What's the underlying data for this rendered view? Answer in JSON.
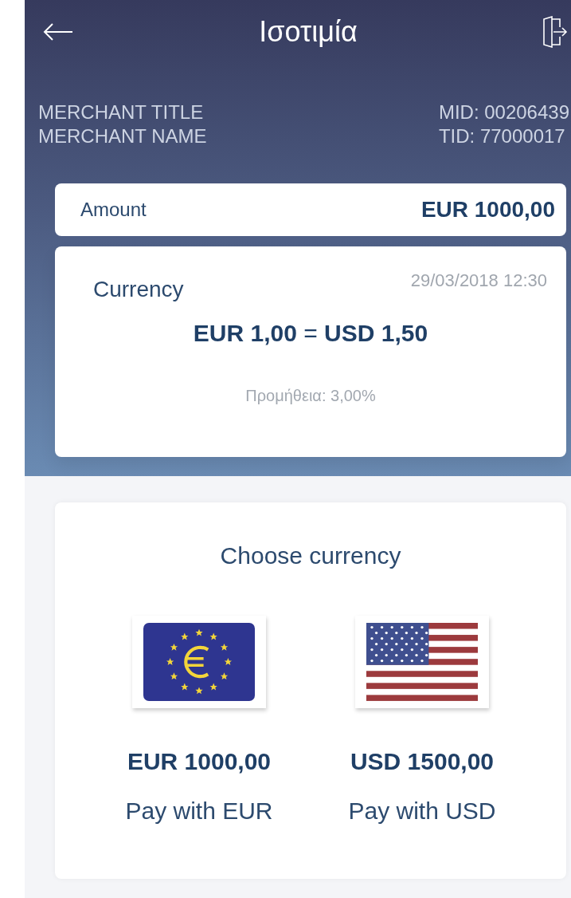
{
  "header": {
    "title": "Ισοτιμία"
  },
  "merchant": {
    "title": "MERCHANT TITLE",
    "name": "MERCHANT NAME",
    "mid": "MID: 00206439",
    "tid": "TID: 77000017"
  },
  "amount": {
    "label": "Amount",
    "value": "EUR 1000,00"
  },
  "currency": {
    "label": "Currency",
    "datetime": "29/03/2018 12:30",
    "rate": "**EUR 1,00** = **USD 1,50**",
    "fee": "Προμήθεια: 3,00%"
  },
  "choose": {
    "title": "Choose currency",
    "options": [
      {
        "kind": "eu",
        "amount": "EUR 1000,00",
        "label": "Pay with EUR"
      },
      {
        "kind": "us",
        "amount": "USD 1500,00",
        "label": "Pay with USD"
      }
    ]
  }
}
